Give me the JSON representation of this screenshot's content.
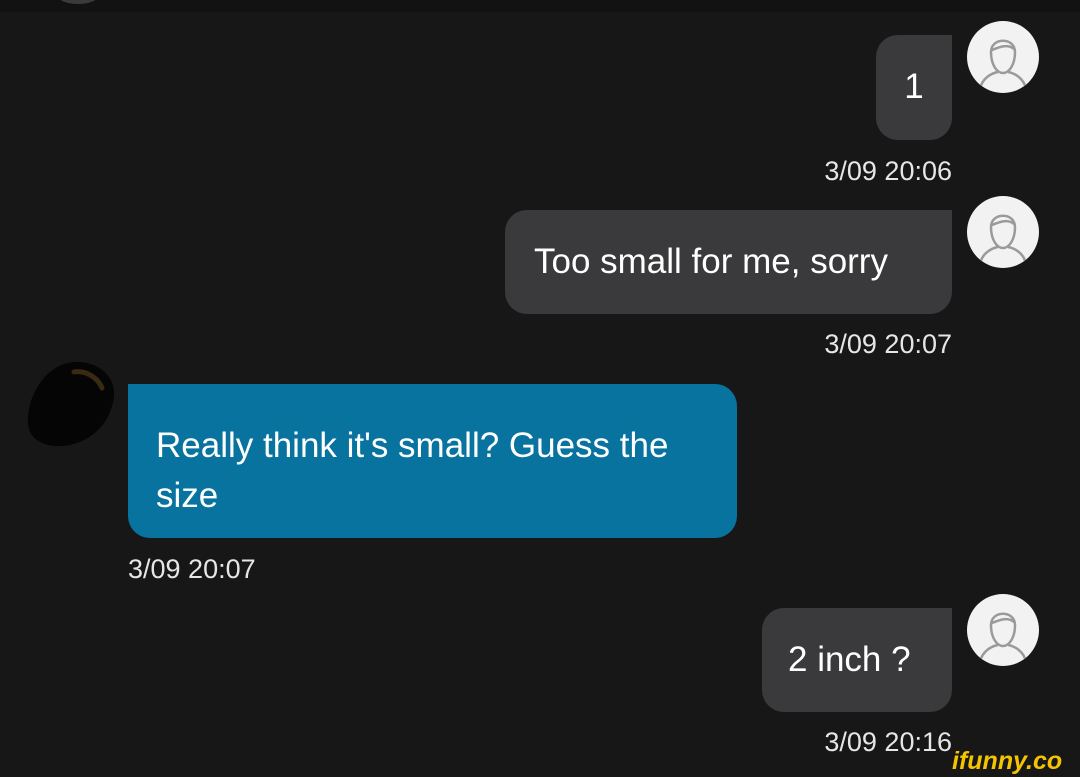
{
  "conversation": {
    "messages": [
      {
        "sender": "me",
        "text": "1",
        "timestamp": "3/09 20:06",
        "avatar_icon": "default-user-icon"
      },
      {
        "sender": "me",
        "text": "Too small for me, sorry",
        "timestamp": "3/09 20:07",
        "avatar_icon": "default-user-icon"
      },
      {
        "sender": "contact",
        "text": "Really think it's small? Guess the size",
        "timestamp": "3/09 20:07",
        "avatar_icon": "dark-photo-avatar"
      },
      {
        "sender": "me",
        "text": "2 inch ?",
        "timestamp": "3/09 20:16",
        "avatar_icon": "default-user-icon"
      }
    ]
  },
  "watermark": {
    "text": "ifunny.co",
    "color": "#f5c400"
  },
  "theme": {
    "background": "#171718",
    "outgoing_bubble": "#3a3a3c",
    "incoming_bubble": "#08739f",
    "text": "#ffffff",
    "timestamp": "#e6e6e6"
  }
}
